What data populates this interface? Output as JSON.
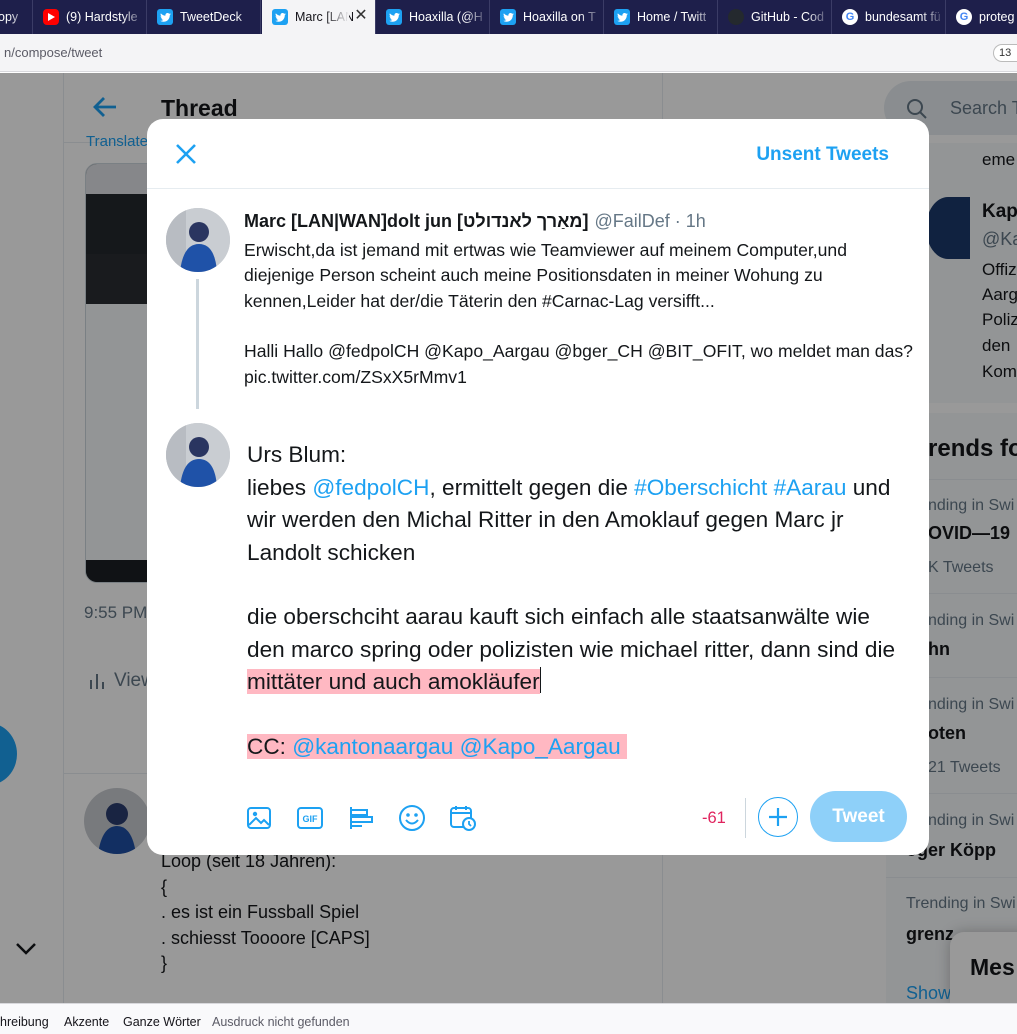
{
  "browser": {
    "tabs": [
      {
        "label": "opy",
        "icon": "document-icon",
        "active": false
      },
      {
        "label": "(9) Hardstyle",
        "icon": "youtube-icon",
        "active": false
      },
      {
        "label": "TweetDeck",
        "icon": "twitter-icon",
        "active": false
      },
      {
        "label": "Marc [LAN",
        "icon": "twitter-icon",
        "active": true
      },
      {
        "label": "Hoaxilla (@H",
        "icon": "twitter-icon",
        "active": false
      },
      {
        "label": "Hoaxilla on T",
        "icon": "twitter-icon",
        "active": false
      },
      {
        "label": "Home / Twitt",
        "icon": "twitter-icon",
        "active": false
      },
      {
        "label": "GitHub - Cod",
        "icon": "github-icon",
        "active": false
      },
      {
        "label": "bundesamt fü",
        "icon": "google-icon",
        "active": false
      },
      {
        "label": "proteg",
        "icon": "google-icon",
        "active": false
      }
    ],
    "url": "n/compose/tweet",
    "zoom_badge": "13"
  },
  "background_page": {
    "thread_title": "Thread",
    "translate_link": "Translate",
    "tweet_time": "9:55 PM",
    "view_activity": "View",
    "reply_lines": [
      "Loop (seit 18 Jahren):",
      "{",
      ". es ist ein Fussball Spiel",
      ". schiesst Toooore [CAPS]",
      "}"
    ],
    "search_placeholder": "Search T",
    "right_fragments": {
      "f1": "eme",
      "kapo_name": "Kap",
      "kapo_handle": "@Ka",
      "bio1": "Offiz",
      "bio2": "Aarg",
      "bio3": "Poliz",
      "bio4": "den",
      "bio5": "Kom",
      "trends_title": "rends fo",
      "t1_ctx": "nding in Swi",
      "t1_name": "OVID—19",
      "t1_count": "K Tweets",
      "t2_ctx": "nding in Swi",
      "t2_name": "hn",
      "t3_ctx": "nding in Swi",
      "t3_name": "oten",
      "t3_count": "21 Tweets",
      "t4_ctx": "nding in Swi",
      "t4_name": "oger Köpp",
      "t5_ctx": "Trending in Swi",
      "t5_name": "grenz",
      "show_more": "Show",
      "messages": "Mes"
    }
  },
  "modal": {
    "unsent_label": "Unsent Tweets",
    "original_tweet": {
      "name": "Marc [LAN|WAN]dolt jun [מאַרך לאנדולט]",
      "handle": "@FailDef",
      "separator": "·",
      "time": "1h",
      "paragraph1": "Erwischt,da ist jemand mit ertwas wie Teamviewer auf meinem Computer,und diejenige Person scheint auch meine Positionsdaten in meiner Wohung zu kennen,Leider hat der/die Täterin den #Carnac-Lag versifft...",
      "paragraph2": "Halli Hallo @fedpolCH @Kapo_Aargau @bger_CH @BIT_OFIT, wo meldet man das? pic.twitter.com/ZSxX5rMmv1"
    },
    "draft": {
      "p1_line1": "Urs Blum:",
      "p1_a": "liebes ",
      "p1_mention": "@fedpolCH",
      "p1_b": ", ermittelt gegen die ",
      "p1_tag1": "#Oberschicht",
      "p1_space": " ",
      "p1_tag2": "#Aarau",
      "p1_c": " und wir werden den Michal Ritter in den Amoklauf gegen Marc jr Landolt schicken",
      "p2_a": "die oberschciht aarau kauft sich einfach alle staatsanwälte wie den marco spring oder polizisten wie michael ritter, dann sind die ",
      "p2_over": "mittäter und auch amokläufer",
      "p3_cc": "CC: ",
      "p3_m1": "@kantonaargau",
      "p3_space": " ",
      "p3_m2": "@Kapo_Aargau",
      "p3_trail": " "
    },
    "char_count": "-61",
    "tweet_button": "Tweet",
    "toolbar_icons": [
      "image-icon",
      "gif-icon",
      "poll-icon",
      "emoji-icon",
      "schedule-icon"
    ]
  },
  "findbar": {
    "item1": "hreibung",
    "item2": "Akzente",
    "item3": "Ganze Wörter",
    "status": "Ausdruck nicht gefunden"
  },
  "colors": {
    "accent": "#1da1f2",
    "over_limit_highlight": "#ffb8c2",
    "over_limit_count": "#e0245e",
    "tweet_button_disabled": "#8ed0f9",
    "tabbar": "#1e1f4b"
  }
}
